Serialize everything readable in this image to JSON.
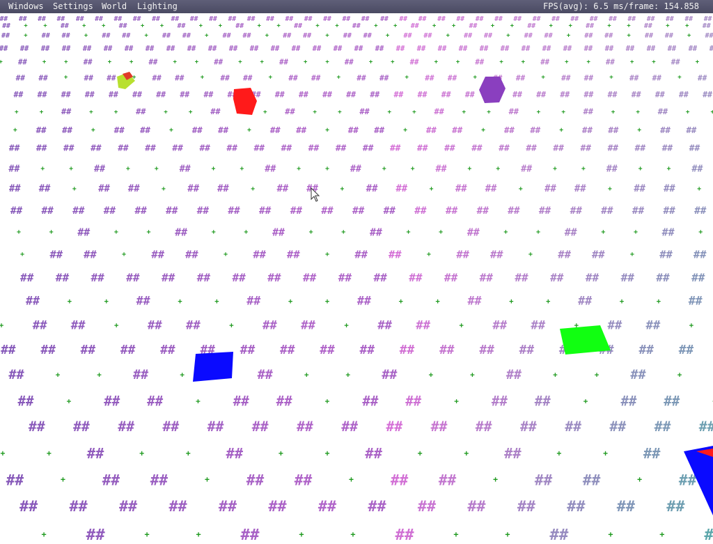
{
  "menubar": {
    "items": [
      {
        "label": "Windows",
        "name": "menu-windows"
      },
      {
        "label": "Settings",
        "name": "menu-settings"
      },
      {
        "label": "World",
        "name": "menu-world"
      },
      {
        "label": "Lighting",
        "name": "menu-lighting"
      }
    ],
    "fps_text": "FPS(avg): 6.5 ms/frame: 154.858"
  },
  "scene": {
    "grass_glyph": "#",
    "marker_glyph": "+",
    "colors": {
      "background": "#ffffff",
      "menubar": "#555570",
      "grass_purple": "#7a55b5",
      "grass_pink": "#d56ed6",
      "grass_teal": "#5aa8aa",
      "marker_green": "#1f9a1f",
      "red_cube": "#ff1a1a",
      "purple_cube": "#8a3fbf",
      "blue_tile": "#0a0aff",
      "green_tile": "#11ff11",
      "yellow_cube": "#b8e030"
    },
    "objects": [
      {
        "name": "red-cube",
        "color": "#ff1a1a"
      },
      {
        "name": "purple-cube",
        "color": "#8a3fbf"
      },
      {
        "name": "blue-tile",
        "color": "#0a0aff"
      },
      {
        "name": "green-tile",
        "color": "#11ff11"
      },
      {
        "name": "yellow-cube",
        "color": "#b8e030"
      },
      {
        "name": "axis-gizmo",
        "color": "#0a0aff"
      }
    ]
  }
}
